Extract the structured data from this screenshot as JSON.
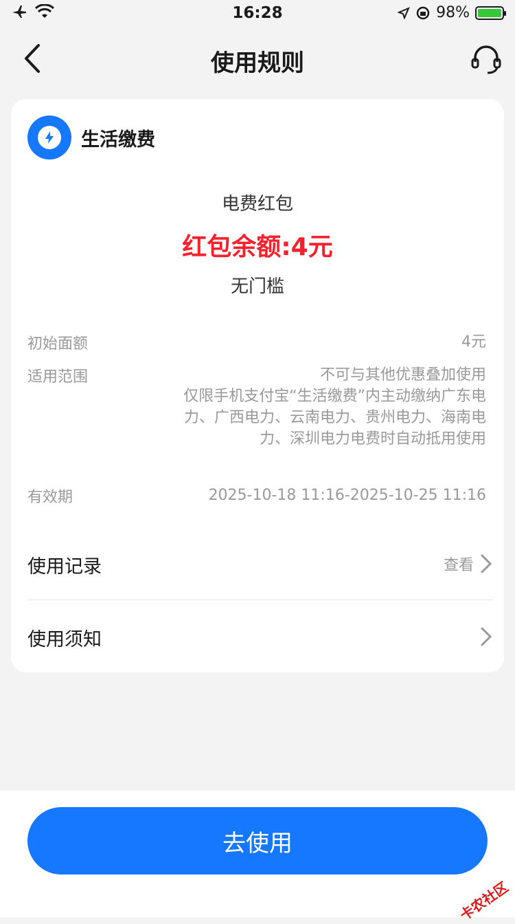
{
  "status_bar": {
    "time": "16:28",
    "battery": "98%"
  },
  "nav": {
    "title": "使用规则"
  },
  "card": {
    "merchant": "生活缴费",
    "coupon_name": "电费红包",
    "balance": "红包余额:4元",
    "threshold": "无门槛",
    "details": [
      {
        "label": "初始面额",
        "value": "4元"
      },
      {
        "label": "适用范围",
        "value": "不可与其他优惠叠加使用\n仅限手机支付宝“生活缴费”内主动缴纳广东电力、广西电力、云南电力、贵州电力、海南电力、深圳电力电费时自动抵用使用"
      },
      {
        "label": "有效期",
        "value": "2025-10-18 11:16-2025-10-25 11:16"
      }
    ],
    "links": {
      "records_label": "使用记录",
      "records_action": "查看",
      "notice_label": "使用须知"
    }
  },
  "footer": {
    "cta": "去使用"
  },
  "watermark": "卡农社区",
  "colors": {
    "accent": "#1677ff",
    "danger": "#f5222d"
  }
}
